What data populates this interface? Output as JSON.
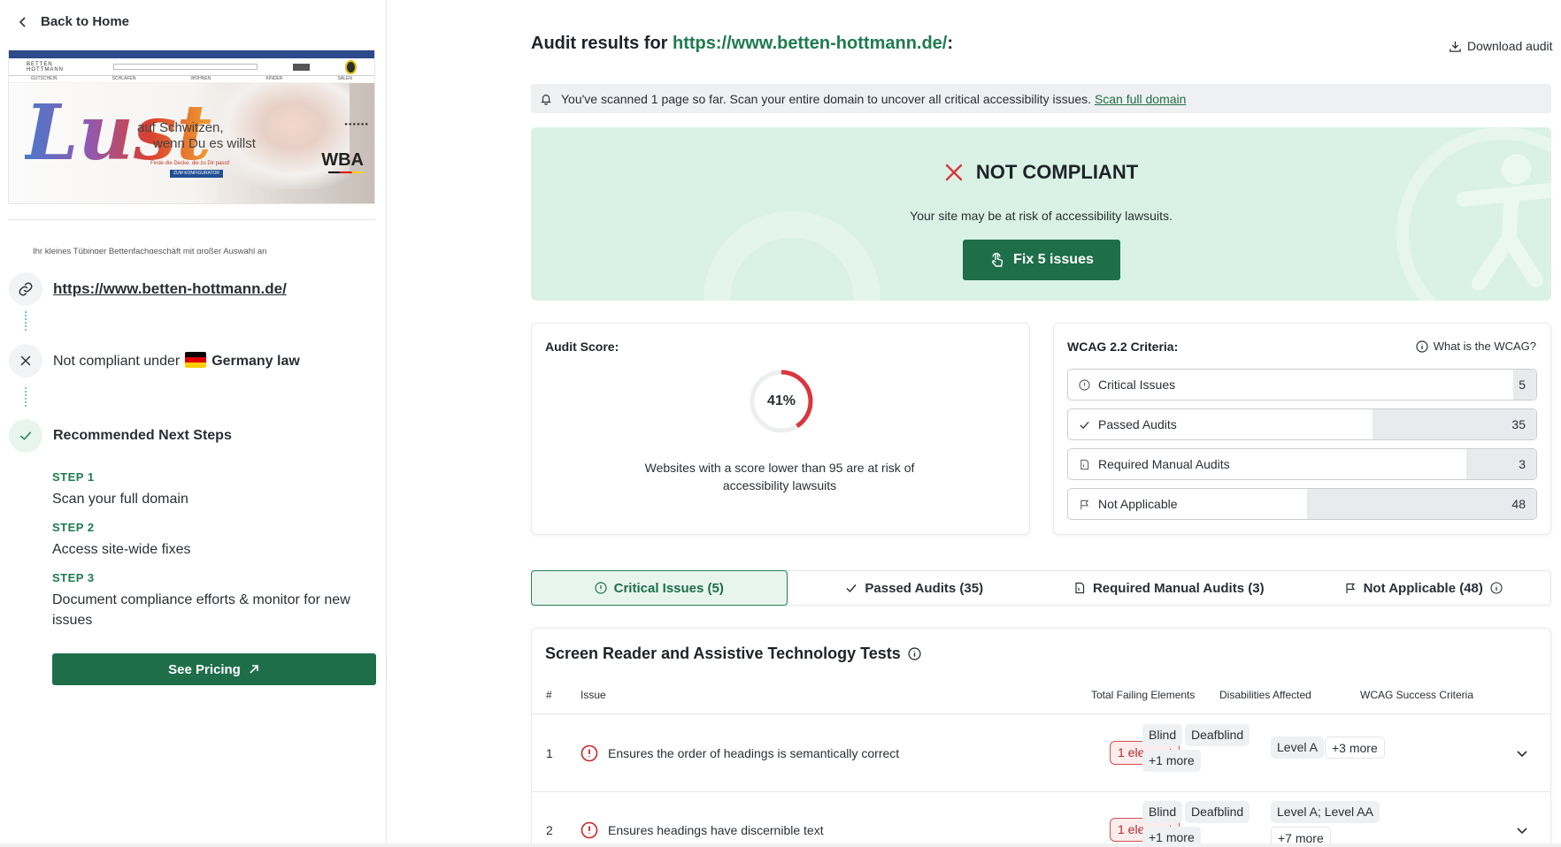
{
  "nav": {
    "back_label": "Back to Home"
  },
  "preview": {
    "headline_script": "Lust",
    "tagline_1": "auf Schwitzen,",
    "tagline_2": "wenn Du es willst",
    "small_text": "Finde die Decke, die zu Dir passt!",
    "cta": "ZUM KONFIGURATOR",
    "brand": "WBA",
    "shop_logo": "BETTEN HOTTMANN",
    "menu": [
      "GUTSCHEIN",
      "SCHLAFEN",
      "WOHNEN",
      "KINDER",
      "SALEN"
    ]
  },
  "site": {
    "description": "Ihr kleines Tübinger Bettenfachgeschäft mit großer Auswahl an",
    "url": "https://www.betten-hottmann.de/"
  },
  "compliance": {
    "prefix": "Not compliant under",
    "law": "Germany law",
    "flag_colors": [
      "#000000",
      "#dd0000",
      "#ffce00"
    ]
  },
  "next_steps": {
    "title": "Recommended Next Steps",
    "steps": [
      {
        "label": "STEP 1",
        "text": "Scan your full domain"
      },
      {
        "label": "STEP 2",
        "text": "Access site-wide fixes"
      },
      {
        "label": "STEP 3",
        "text": "Document compliance efforts & monitor for new issues"
      }
    ],
    "pricing_label": "See Pricing"
  },
  "header": {
    "title_prefix": "Audit results for",
    "title_url": "https://www.betten-hottmann.de/",
    "title_suffix": ":",
    "download_label": "Download audit"
  },
  "banner": {
    "text": "You've scanned 1 page so far. Scan your entire domain to uncover all critical accessibility issues.",
    "link": "Scan full domain"
  },
  "status": {
    "title": "NOT COMPLIANT",
    "subtitle": "Your site may be at risk of accessibility lawsuits.",
    "fix_label": "Fix 5 issues"
  },
  "score": {
    "title": "Audit Score:",
    "value": 41,
    "value_label": "41%",
    "note": "Websites with a score lower than 95 are at risk of accessibility lawsuits"
  },
  "wcag": {
    "title": "WCAG 2.2 Criteria:",
    "help_label": "What is the WCAG?",
    "items": [
      {
        "label": "Critical Issues",
        "count": "5",
        "fill": 0.05
      },
      {
        "label": "Passed Audits",
        "count": "35",
        "fill": 0.35
      },
      {
        "label": "Required Manual Audits",
        "count": "3",
        "fill": 0.15
      },
      {
        "label": "Not Applicable",
        "count": "48",
        "fill": 0.49
      }
    ]
  },
  "tabs": [
    {
      "label": "Critical Issues (5)",
      "active": true
    },
    {
      "label": "Passed Audits (35)",
      "active": false
    },
    {
      "label": "Required Manual Audits (3)",
      "active": false
    },
    {
      "label": "Not Applicable (48)",
      "active": false
    }
  ],
  "results": {
    "section_title": "Screen Reader and Assistive Technology Tests",
    "columns": [
      "#",
      "Issue",
      "Total Failing Elements",
      "Disabilities Affected",
      "WCAG Success Criteria"
    ],
    "rows": [
      {
        "num": "1",
        "issue": "Ensures the order of headings is semantically correct",
        "elements": "1 element",
        "disabilities": [
          "Blind",
          "Deafblind"
        ],
        "disabilities_more": "+1 more",
        "criteria": "Level A",
        "criteria_more": "+3 more"
      },
      {
        "num": "2",
        "issue": "Ensures headings have discernible text",
        "elements": "1 element",
        "disabilities": [
          "Blind",
          "Deafblind"
        ],
        "disabilities_more": "+1 more",
        "criteria": "Level A; Level AA",
        "criteria_more": "+7 more"
      }
    ]
  },
  "colors": {
    "accent": "#1e6e4a",
    "hero_bg": "#d9f2e5",
    "danger": "#d9363e"
  }
}
